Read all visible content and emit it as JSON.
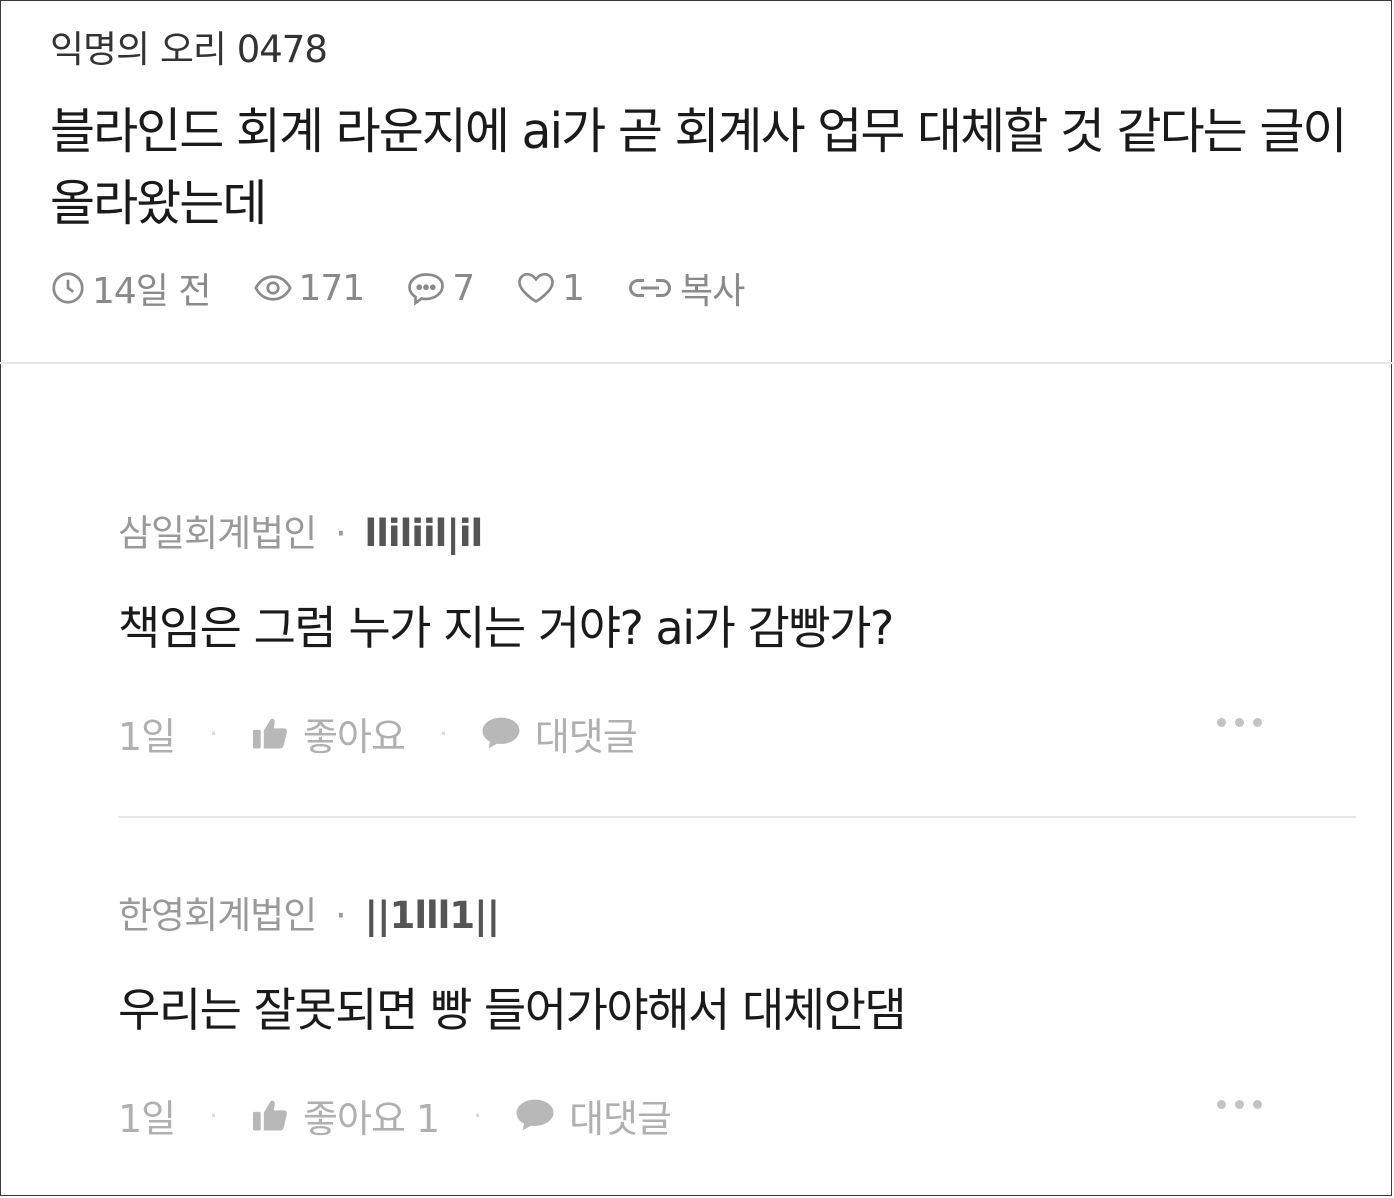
{
  "post": {
    "author": "익명의 오리 0478",
    "title": "블라인드 회계 라운지에 ai가 곧 회계사 업무 대체할 것 같다는 글이 올라왔는데",
    "meta": {
      "time": "14일 전",
      "views": "171",
      "comments": "7",
      "likes": "1",
      "copy_label": "복사"
    }
  },
  "comments": [
    {
      "company": "삼일회계법인",
      "separator": "·",
      "nickname": "lliliil|il",
      "body": "책임은 그럼 누가 지는 거야?  ai가 감빵가?",
      "time": "1일",
      "like_label": "좋아요",
      "reply_label": "대댓글"
    },
    {
      "company": "한영회계법인",
      "separator": "·",
      "nickname": "||1lll1||",
      "body": "우리는 잘못되면 빵 들어가야해서 대체안댐",
      "time": "1일",
      "like_label": "좋아요 1",
      "reply_label": "대댓글"
    }
  ],
  "icons": {
    "time": "clock-icon",
    "views": "eye-icon",
    "comments": "chat-bubble-icon",
    "likes": "heart-icon",
    "copy": "link-icon",
    "like": "thumbs-up-icon",
    "reply": "speech-bubble-icon",
    "more": "more-dots-icon"
  },
  "colors": {
    "text_primary": "#1a1a1a",
    "text_meta": "#8a8a8a",
    "text_muted": "#b0b0b0",
    "divider": "#e6e6e6"
  }
}
